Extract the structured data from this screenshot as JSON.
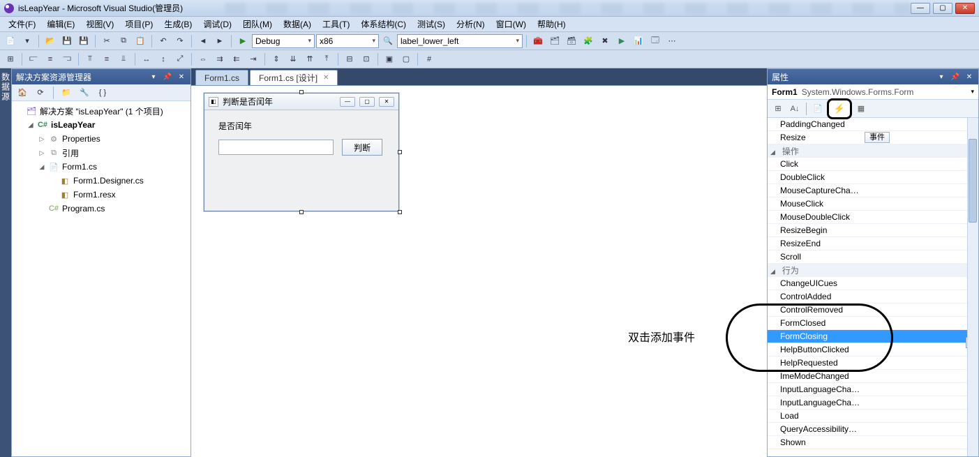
{
  "titlebar": {
    "title": "isLeapYear - Microsoft Visual Studio(管理员)"
  },
  "menus": [
    "文件(F)",
    "编辑(E)",
    "视图(V)",
    "项目(P)",
    "生成(B)",
    "调试(D)",
    "团队(M)",
    "数据(A)",
    "工具(T)",
    "体系结构(C)",
    "测试(S)",
    "分析(N)",
    "窗口(W)",
    "帮助(H)"
  ],
  "toolbars": {
    "config": "Debug",
    "platform": "x86",
    "find": "label_lower_left"
  },
  "solution_explorer": {
    "title": "解决方案资源管理器",
    "solution": "解决方案 \"isLeapYear\" (1 个项目)",
    "project": "isLeapYear",
    "nodes": {
      "properties": "Properties",
      "references": "引用",
      "form": "Form1.cs",
      "designer": "Form1.Designer.cs",
      "resx": "Form1.resx",
      "program": "Program.cs"
    }
  },
  "tabs": {
    "tab1": "Form1.cs",
    "tab2": "Form1.cs [设计]"
  },
  "form_designer": {
    "window_title": "判断是否闰年",
    "label": "是否闰年",
    "button": "判断"
  },
  "annotation": "双击添加事件",
  "vtab_left": "数据源",
  "properties_panel": {
    "title": "属性",
    "object_name": "Form1",
    "object_type": "System.Windows.Forms.Form",
    "resize_event_btn": "事件",
    "categories": {
      "cat1": "操作",
      "cat2": "行为"
    },
    "events": [
      "PaddingChanged",
      "Resize",
      "Click",
      "DoubleClick",
      "MouseCaptureChanged",
      "MouseClick",
      "MouseDoubleClick",
      "ResizeBegin",
      "ResizeEnd",
      "Scroll",
      "ChangeUICues",
      "ControlAdded",
      "ControlRemoved",
      "FormClosed",
      "FormClosing",
      "HelpButtonClicked",
      "HelpRequested",
      "ImeModeChanged",
      "InputLanguageChanged",
      "InputLanguageChanging",
      "Load",
      "QueryAccessibilityHelpRequested",
      "Shown"
    ]
  }
}
